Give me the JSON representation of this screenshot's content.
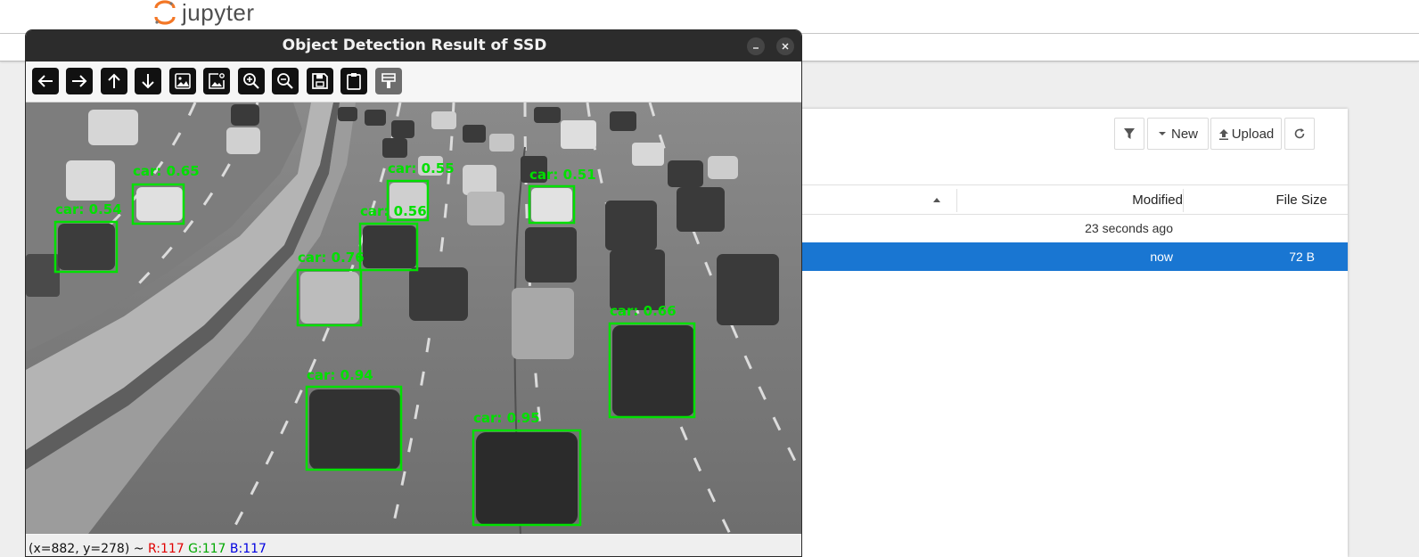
{
  "jupyter": {
    "logo_text": "jupyter",
    "toolbar": {
      "new_label": "New",
      "upload_label": "Upload"
    },
    "columns": {
      "modified": "Modified",
      "file_size": "File Size"
    },
    "files": [
      {
        "modified": "23 seconds ago",
        "size": "",
        "selected": false
      },
      {
        "modified": "now",
        "size": "72 B",
        "selected": true
      }
    ],
    "accent_color": "#1976d2"
  },
  "viewer": {
    "title": "Object Detection Result of SSD",
    "tools": [
      "back-icon",
      "forward-icon",
      "up-icon",
      "down-icon",
      "image-icon",
      "image-settings-icon",
      "zoom-in-icon",
      "zoom-out-icon",
      "save-icon",
      "clipboard-icon",
      "brush-icon"
    ],
    "status": {
      "coords": "(x=882, y=278) ~ ",
      "r": "R:117",
      "g": "G:117",
      "b": "B:117"
    },
    "detections": [
      {
        "label": "car: 0.65"
      },
      {
        "label": "car: 0.54"
      },
      {
        "label": "car: 0.55"
      },
      {
        "label": "car: 0.56"
      },
      {
        "label": "car: 0.51"
      },
      {
        "label": "car: 0.76"
      },
      {
        "label": "car: 0.66"
      },
      {
        "label": "car: 0.94"
      },
      {
        "label": "car: 0.95"
      }
    ],
    "box_color": "#00e000"
  }
}
